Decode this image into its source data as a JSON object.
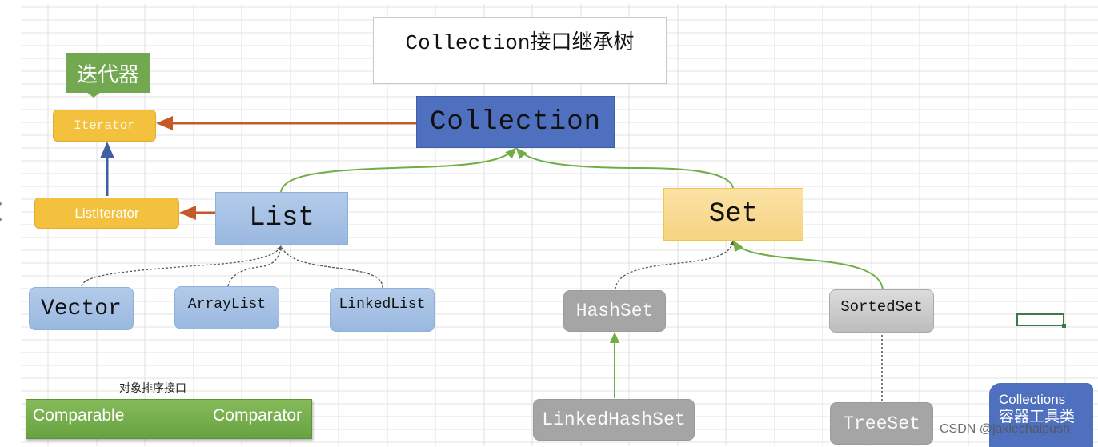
{
  "title": "Collection接口继承树",
  "nodes": {
    "collection": "Collection",
    "iterator_label": "迭代器",
    "iterator": "Iterator",
    "list_iterator": "ListIterator",
    "list": "List",
    "set": "Set",
    "vector": "Vector",
    "arraylist": "ArrayList",
    "linkedlist": "LinkedList",
    "hashset": "HashSet",
    "sortedset": "SortedSet",
    "linkedhashset": "LinkedHashSet",
    "treeset": "TreeSet"
  },
  "sorting": {
    "caption": "对象排序接口",
    "comparable": "Comparable",
    "comparator": "Comparator"
  },
  "tools": {
    "line1": "Collections",
    "line2": "容器工具类"
  },
  "watermark": "CSDN @jakiechaipush",
  "colors": {
    "collection": "#4f70be",
    "iterator": "#f4c13f",
    "list": "#9ab8e0",
    "set": "#f6d383",
    "impl_gray": "#a5a5a5",
    "label_green": "#72a84f",
    "arrow_orange": "#c55a28",
    "arrow_blue": "#3f5ea3",
    "arrow_green": "#70ad47",
    "dashed": "#555555"
  },
  "edges": [
    {
      "from": "collection",
      "to": "iterator",
      "style": "solid-orange"
    },
    {
      "from": "list_iterator",
      "to": "iterator",
      "style": "solid-blue"
    },
    {
      "from": "list",
      "to": "list_iterator",
      "style": "solid-orange"
    },
    {
      "from": "list",
      "to": "collection",
      "style": "solid-green"
    },
    {
      "from": "set",
      "to": "collection",
      "style": "solid-green"
    },
    {
      "from": "vector",
      "to": "list",
      "style": "dashed"
    },
    {
      "from": "arraylist",
      "to": "list",
      "style": "dashed"
    },
    {
      "from": "linkedlist",
      "to": "list",
      "style": "dashed"
    },
    {
      "from": "hashset",
      "to": "set",
      "style": "dashed"
    },
    {
      "from": "sortedset",
      "to": "set",
      "style": "solid-green"
    },
    {
      "from": "linkedhashset",
      "to": "hashset",
      "style": "solid-green"
    },
    {
      "from": "treeset",
      "to": "sortedset",
      "style": "dashed"
    }
  ]
}
